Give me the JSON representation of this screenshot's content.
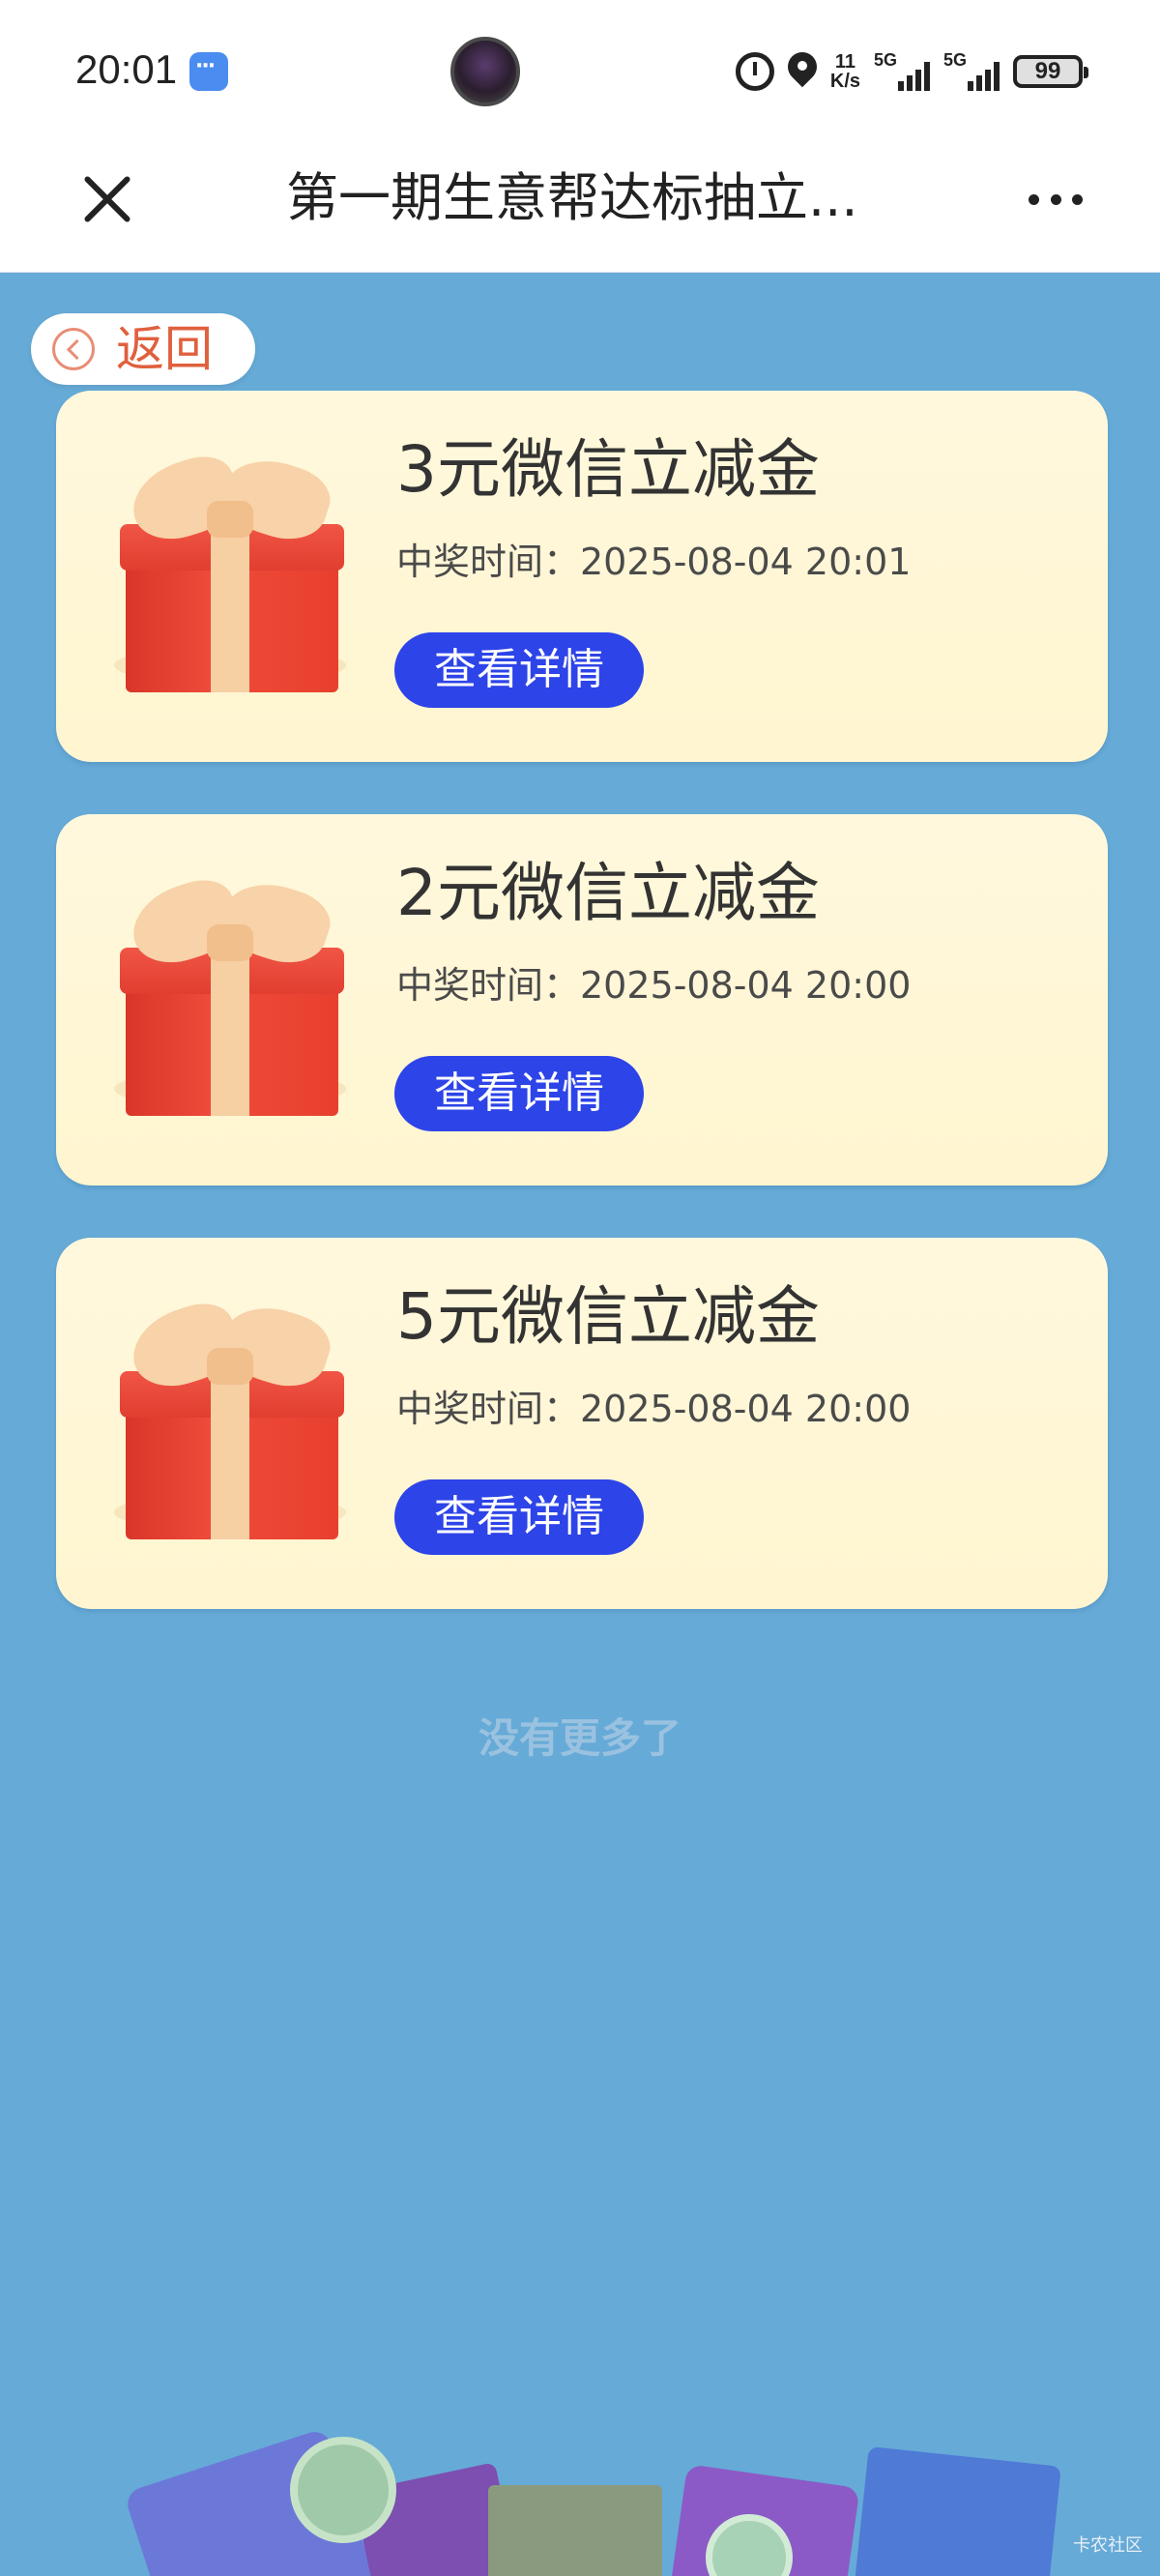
{
  "status_bar": {
    "time": "20:01",
    "net_speed_value": "11",
    "net_speed_unit": "K/s",
    "signal1_label": "5G",
    "signal2_label": "5G",
    "battery": "99"
  },
  "title_bar": {
    "title": "第一期生意帮达标抽立..."
  },
  "back": {
    "label": "返回"
  },
  "prizes": [
    {
      "name": "3元微信立减金",
      "time": "中奖时间：2025-08-04 20:01",
      "button": "查看详情"
    },
    {
      "name": "2元微信立减金",
      "time": "中奖时间：2025-08-04 20:00",
      "button": "查看详情"
    },
    {
      "name": "5元微信立减金",
      "time": "中奖时间：2025-08-04 20:00",
      "button": "查看详情"
    }
  ],
  "footer": {
    "no_more": "没有更多了"
  },
  "watermark": "卡农社区",
  "colors": {
    "background": "#66aad7",
    "card": "#fff7d8",
    "button": "#2d44e8",
    "back_text": "#e0603e"
  }
}
